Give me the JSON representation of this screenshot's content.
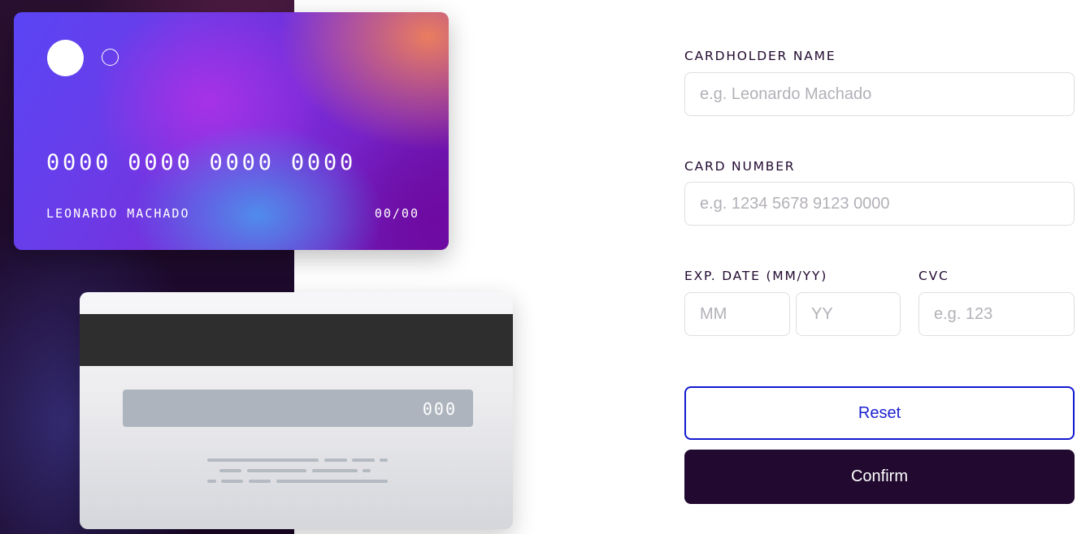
{
  "card_front": {
    "number": "0000 0000 0000 0000",
    "holder_name": "LEONARDO MACHADO",
    "expiry": "00/00"
  },
  "card_back": {
    "cvc": "000"
  },
  "form": {
    "cardholder_name": {
      "label": "CARDHOLDER NAME",
      "placeholder": "e.g. Leonardo Machado",
      "value": ""
    },
    "card_number": {
      "label": "CARD NUMBER",
      "placeholder": "e.g. 1234 5678 9123 0000",
      "value": ""
    },
    "exp_date": {
      "label": "EXP. DATE (MM/YY)",
      "month_placeholder": "MM",
      "year_placeholder": "YY"
    },
    "cvc": {
      "label": "CVC",
      "placeholder": "e.g. 123"
    },
    "reset_label": "Reset",
    "confirm_label": "Confirm"
  },
  "colors": {
    "dark_violet": "#21092f",
    "reset_border": "#1219cf",
    "input_border": "#dfdee0",
    "placeholder": "#b3b0b7"
  }
}
